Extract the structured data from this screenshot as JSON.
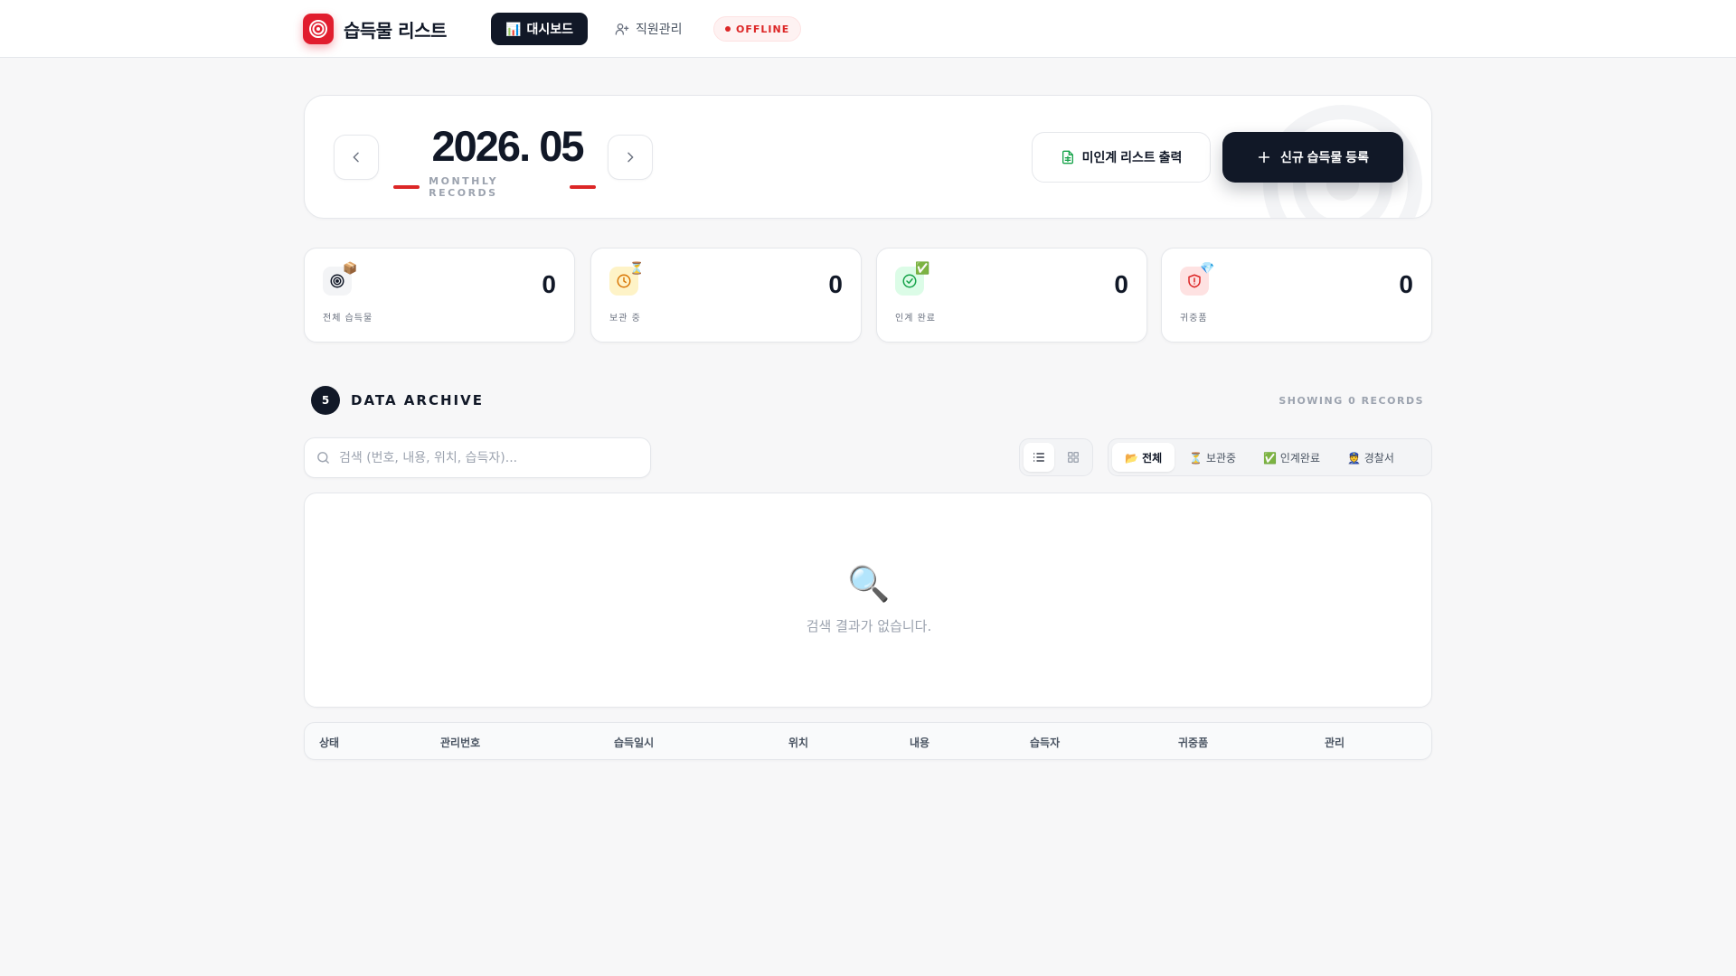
{
  "header": {
    "brand_title": "습득물 리스트",
    "nav_dashboard_emoji": "📊",
    "nav_dashboard": "대시보드",
    "nav_staff": "직원관리",
    "status_badge": "OFFLINE"
  },
  "period": {
    "month": "2026. 05",
    "subtitle": "MONTHLY RECORDS"
  },
  "actions": {
    "export_label": "미인계 리스트 출력",
    "new_label": "신규 습득물 등록"
  },
  "stats": [
    {
      "label": "전체 습득물",
      "value": "0",
      "emoji": "📦"
    },
    {
      "label": "보관 중",
      "value": "0",
      "emoji": "⏳"
    },
    {
      "label": "인계 완료",
      "value": "0",
      "emoji": "✅"
    },
    {
      "label": "귀중품",
      "value": "0",
      "emoji": "💎"
    }
  ],
  "archive": {
    "number": "5",
    "title": "DATA ARCHIVE",
    "showing": "SHOWING 0 RECORDS"
  },
  "search": {
    "placeholder": "검색 (번호, 내용, 위치, 습득자)...",
    "value": ""
  },
  "filters": [
    {
      "label": "📂 전체",
      "active": true
    },
    {
      "label": "⏳ 보관중",
      "active": false
    },
    {
      "label": "✅ 인계완료",
      "active": false
    },
    {
      "label": "👮 경찰서",
      "active": false
    }
  ],
  "empty_state": {
    "icon": "🔍",
    "message": "검색 결과가 없습니다."
  },
  "table": {
    "columns": [
      "상태",
      "관리번호",
      "습득일시",
      "위치",
      "내용",
      "습득자",
      "귀중품",
      "관리"
    ]
  },
  "colors": {
    "accent_red": "#dc2626",
    "dark": "#111827",
    "bg": "#f7f7f8"
  }
}
